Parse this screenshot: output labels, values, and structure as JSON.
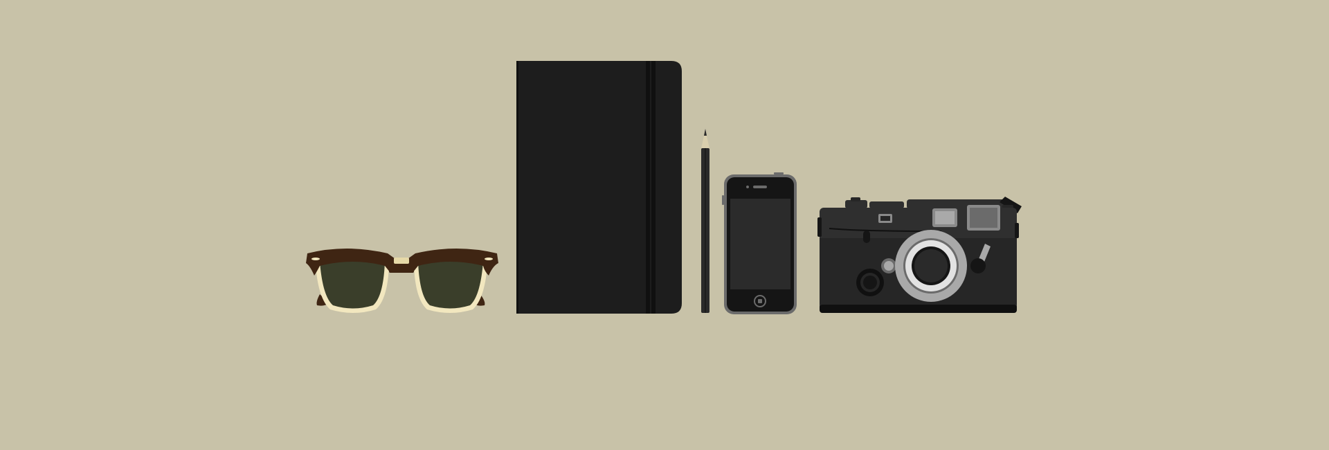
{
  "scene": {
    "objects": [
      "sunglasses",
      "notebook",
      "pencil",
      "smartphone",
      "camera"
    ]
  },
  "colors": {
    "background": "#c8c2a8",
    "sunglasses_frame": "#3f2513",
    "sunglasses_rim": "#f2e7bf",
    "sunglasses_lens": "#3a3e2a",
    "sunglasses_bridge": "#e6d9a8",
    "notebook": "#1d1d1d",
    "notebook_band": "#101010",
    "pencil": "#2a2a2a",
    "pencil_wood": "#d9cfae",
    "phone_frame": "#6b6b6b",
    "phone_body": "#151515",
    "phone_screen": "#2b2b2b",
    "camera_body": "#2f2f2f",
    "camera_leather": "#262626",
    "camera_lens_ring": "#a9a9a9",
    "camera_lens_inner": "#e2e2e2",
    "camera_lens_core": "#2a2a2a",
    "camera_window": "#8a8a8a"
  }
}
